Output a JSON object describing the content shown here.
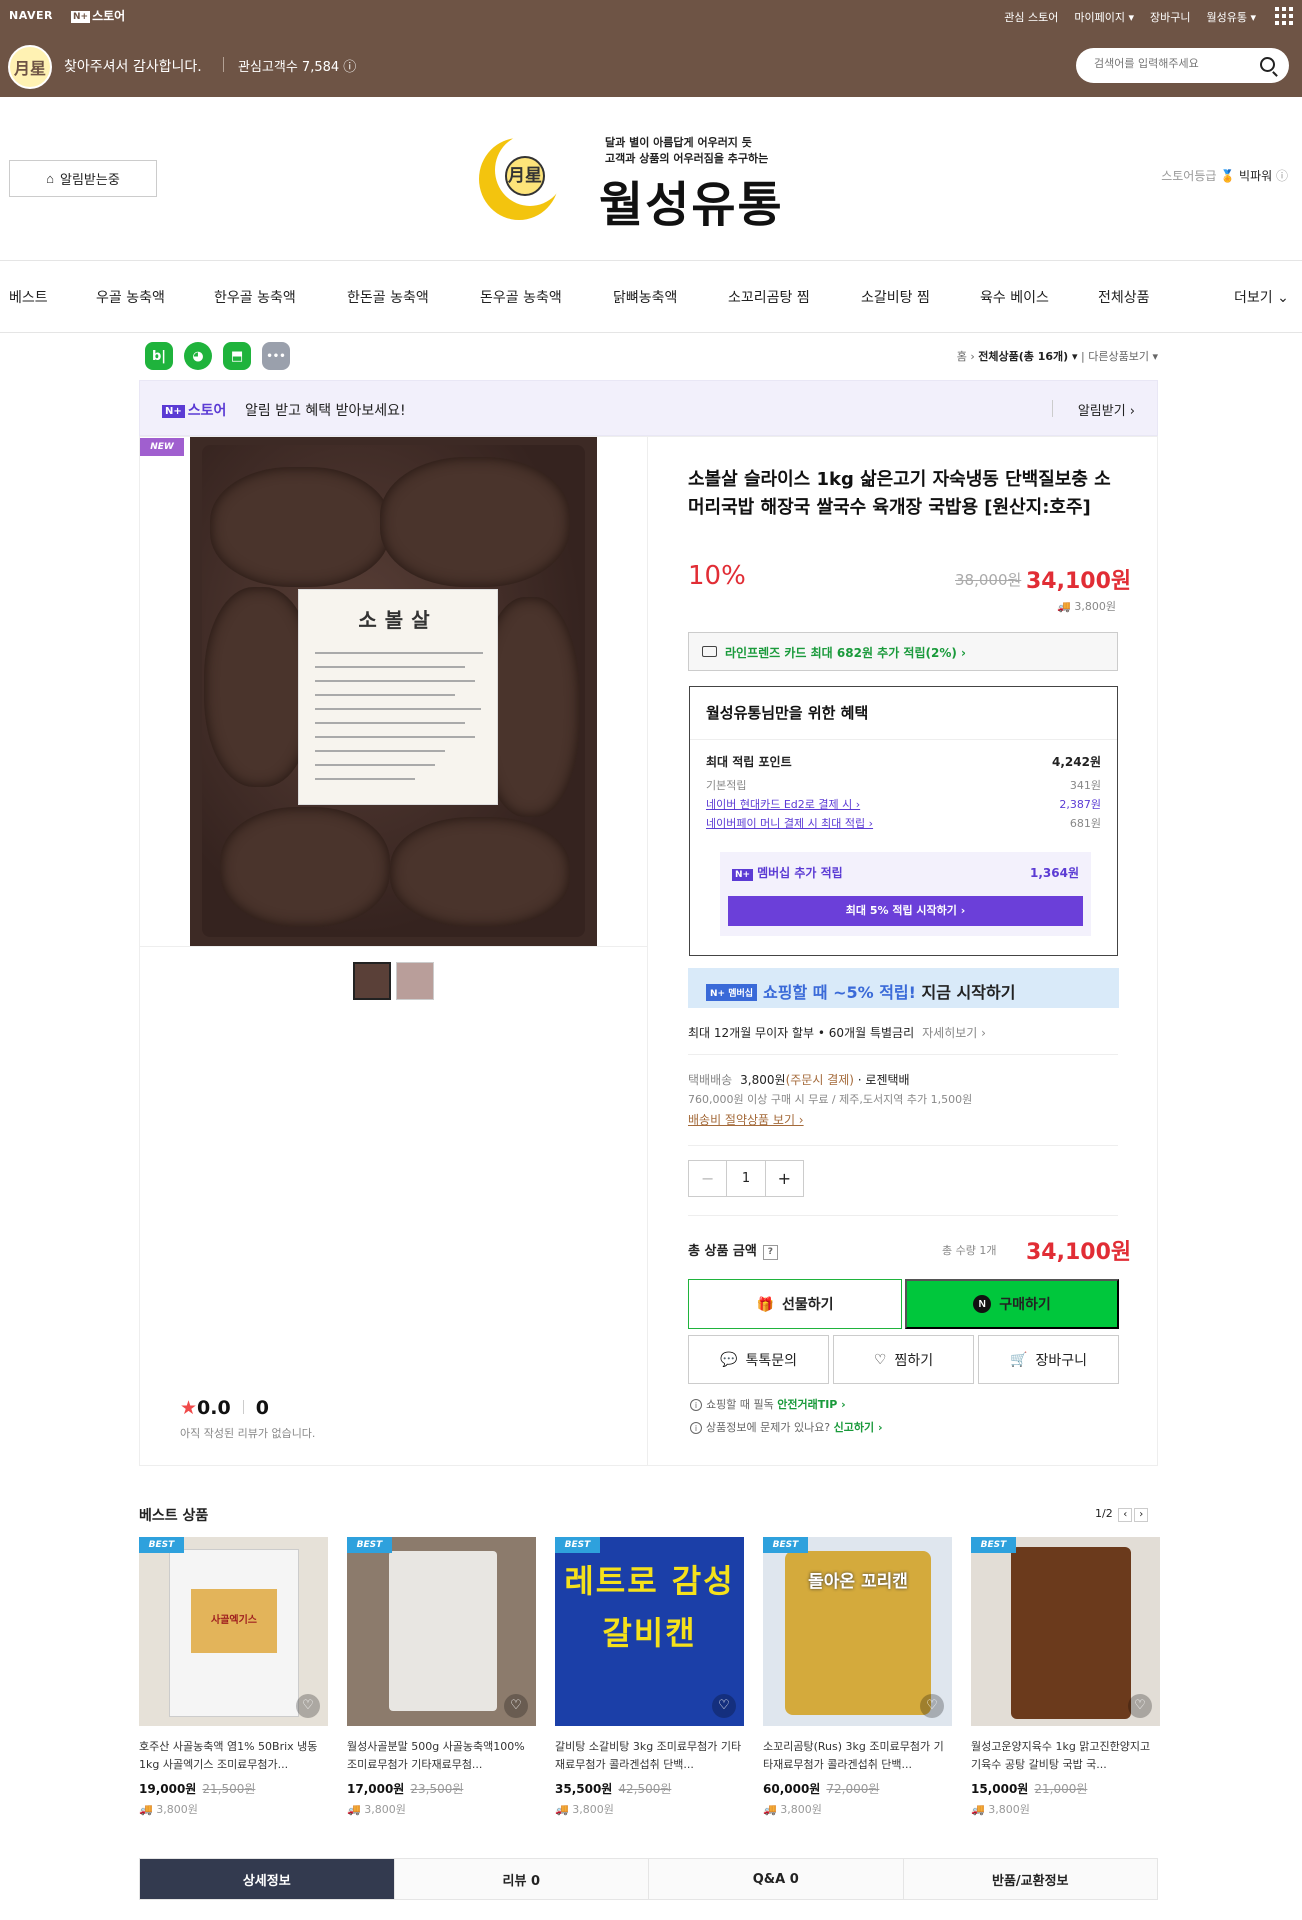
{
  "topbar": {
    "naver": "NAVER",
    "store_badge": "N+",
    "store_label": "스토어",
    "links": [
      "관심 스토어",
      "마이페이지 ▾",
      "장바구니",
      "월성유통 ▾"
    ],
    "welcome": "찾아주셔서 감사합니다.",
    "visitors": "관심고객수 7,584 ⓘ",
    "search_placeholder": "검색어를 입력해주세요",
    "bg_color": "#6e5445"
  },
  "header": {
    "notify_button": "알림받는중",
    "slogan1": "달과 별이 아름답게 어우러지 듯",
    "slogan2": "고객과 상품의 어우러짐을 추구하는",
    "logo_text": "월성유통",
    "logo_mark": "月星",
    "grade_label": "스토어등급",
    "grade_value": "빅파워"
  },
  "gnb": {
    "items": [
      "베스트",
      "우골 농축액",
      "한우골 농축액",
      "한돈골 농축액",
      "돈우골 농축액",
      "닭뼈농축액",
      "소꼬리곰탕 찜",
      "소갈비탕 찜",
      "육수 베이스",
      "전체상품",
      "더보기 ⌄"
    ]
  },
  "share": [
    "b|",
    "◕",
    "⬒",
    "•••"
  ],
  "breadcrumb": {
    "home": "홈",
    "all": "전체상품(총 16개) ▾",
    "other": "다른상품보기 ▾"
  },
  "banner": {
    "badge": "N+",
    "store": "스토어",
    "message": "알림 받고 혜택 받아보세요!",
    "button": "알림받기 ›"
  },
  "product": {
    "new_badge": "NEW",
    "label_title": "소볼살",
    "title": "소볼살 슬라이스 1kg 삶은고기 자숙냉동 단백질보충 소머리국밥 해장국 쌀국수 육개장 국밥용 [원산지:호주]",
    "discount": "10%",
    "original_price": "38,000원",
    "price": "34,100원",
    "shipping_fee": "3,800원",
    "card_benefit": "라인프렌즈 카드 최대 682원 추가 적립(2%) ›",
    "rating": "0.0",
    "review_count": "0",
    "no_review": "아직 작성된 리뷰가 없습니다."
  },
  "benefit": {
    "heading": "월성유통님만을 위한 혜택",
    "max_points_label": "최대 적립 포인트",
    "max_points": "4,242원",
    "rows": [
      {
        "label": "기본적립",
        "value": "341원"
      },
      {
        "label": "네이버 현대카드 Ed2로 결제 시 ›",
        "value": "2,387원"
      },
      {
        "label": "네이버페이 머니 결제 시 최대 적립 ›",
        "value": "681원"
      }
    ],
    "membership_label": "멤버십 추가 적립",
    "membership_value": "1,364원",
    "membership_button": "최대 5% 적립 시작하기 ›"
  },
  "nplus_banner": {
    "badge": "N+ 멤버십",
    "text": "쇼핑할 때 ~5% 적립!",
    "text2": " 지금 시작하기"
  },
  "installment": {
    "text": "최대 12개월 무이자 할부 • 60개월 특별금리",
    "more": "자세히보기 ›"
  },
  "delivery": {
    "label": "택배배송",
    "fee": "3,800원",
    "note": "(주문시 결제)",
    "carrier": "· 로젠택배",
    "condition": "760,000원 이상 구매 시 무료 / 제주,도서지역 추가 1,500원",
    "link": "배송비 절약상품 보기 ›"
  },
  "quantity": {
    "minus": "−",
    "value": "1",
    "plus": "+"
  },
  "total": {
    "label": "총 상품 금액",
    "help": "?",
    "count": "총 수량 1개",
    "price": "34,100원"
  },
  "buttons": {
    "gift": "선물하기",
    "buy": "구매하기",
    "talk": "톡톡문의",
    "wish": "찜하기",
    "cart": "장바구니"
  },
  "tips": [
    {
      "text": "쇼핑할 때 필독 ",
      "link": "안전거래TIP ›"
    },
    {
      "text": "상품정보에 문제가 있나요? ",
      "link": "신고하기 ›"
    }
  ],
  "best": {
    "heading": "베스트 상품",
    "page": "1/2",
    "items": [
      {
        "badge": "BEST",
        "title": "호주산 사골농축액 염1% 50Brix 냉동 1kg 사골엑기스 조미료무첨가...",
        "price": "19,000원",
        "orig": "21,500원",
        "ship": "3,800원",
        "img_text": "사골엑기스"
      },
      {
        "badge": "BEST",
        "title": "월성사골분말 500g 사골농축액100% 조미료무첨가 기타재료무첨...",
        "price": "17,000원",
        "orig": "23,500원",
        "ship": "3,800원",
        "img_text": ""
      },
      {
        "badge": "BEST",
        "title": "갈비탕 소갈비탕 3kg 조미료무첨가 기타재료무첨가 콜라겐섭취 단백...",
        "price": "35,500원",
        "orig": "42,500원",
        "ship": "3,800원",
        "img_text": "레트로 감성 갈비캔"
      },
      {
        "badge": "BEST",
        "title": "소꼬리곰탕(Rus) 3kg 조미료무첨가 기타재료무첨가 콜라겐섭취 단백...",
        "price": "60,000원",
        "orig": "72,000원",
        "ship": "3,800원",
        "img_text": "돌아온 꼬리캔"
      },
      {
        "badge": "BEST",
        "title": "월성고운양지육수 1kg 맑고진한양지고기육수 공탕 갈비탕 국밥 국...",
        "price": "15,000원",
        "orig": "21,000원",
        "ship": "3,800원",
        "img_text": ""
      }
    ]
  },
  "tabs": [
    "상세정보",
    "리뷰 0",
    "Q&A 0",
    "반품/교환정보"
  ]
}
